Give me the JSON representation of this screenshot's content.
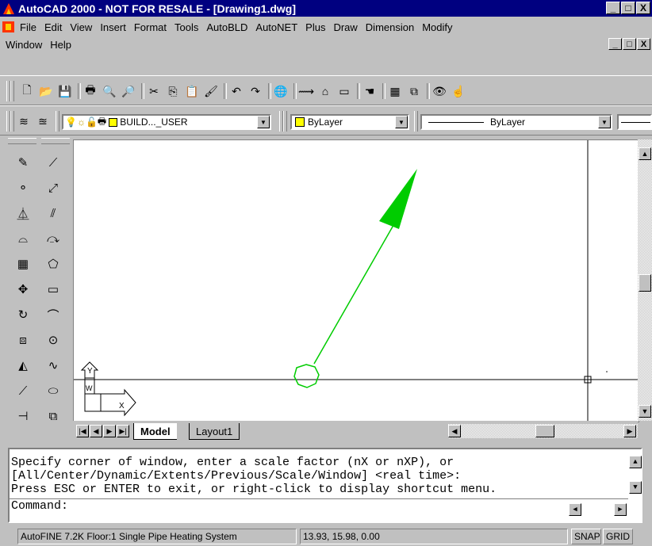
{
  "window": {
    "title": "AutoCAD 2000 - NOT FOR RESALE - [Drawing1.dwg]",
    "controls": [
      "_",
      "□",
      "X"
    ]
  },
  "menu": {
    "row1": [
      "File",
      "Edit",
      "View",
      "Insert",
      "Format",
      "Tools",
      "AutoBLD",
      "AutoNET",
      "Plus",
      "Draw",
      "Dimension",
      "Modify"
    ],
    "row2": [
      "Window",
      "Help"
    ],
    "mdi_controls": [
      "_",
      "□",
      "X"
    ]
  },
  "properties_toolbar": {
    "layer_value": "BUILD..._USER",
    "color_value": "ByLayer",
    "linetype_value": "ByLayer"
  },
  "model_tabs": {
    "tabs": [
      "Model",
      "Layout1"
    ],
    "active": "Model"
  },
  "ucs_icon": {
    "y_label": "Y",
    "x_label": "X",
    "w_label": "W"
  },
  "command_window": {
    "lines": [
      "Specify corner of window, enter a scale factor (nX or nXP), or",
      "[All/Center/Dynamic/Extents/Previous/Scale/Window] <real time>:",
      "Press ESC or ENTER to exit, or right-click to display shortcut menu.",
      "Command:"
    ]
  },
  "status": {
    "app_info": "AutoFINE 7.2K Floor:1 Single Pipe Heating System",
    "coordinates": "13.93, 15.98, 0.00",
    "snap": "SNAP",
    "grid": "GRID"
  },
  "colors": {
    "title_bg": "#000080",
    "drawing_green": "#00cc00",
    "canvas_bg": "#ffffff",
    "chrome": "#c0c0c0"
  }
}
